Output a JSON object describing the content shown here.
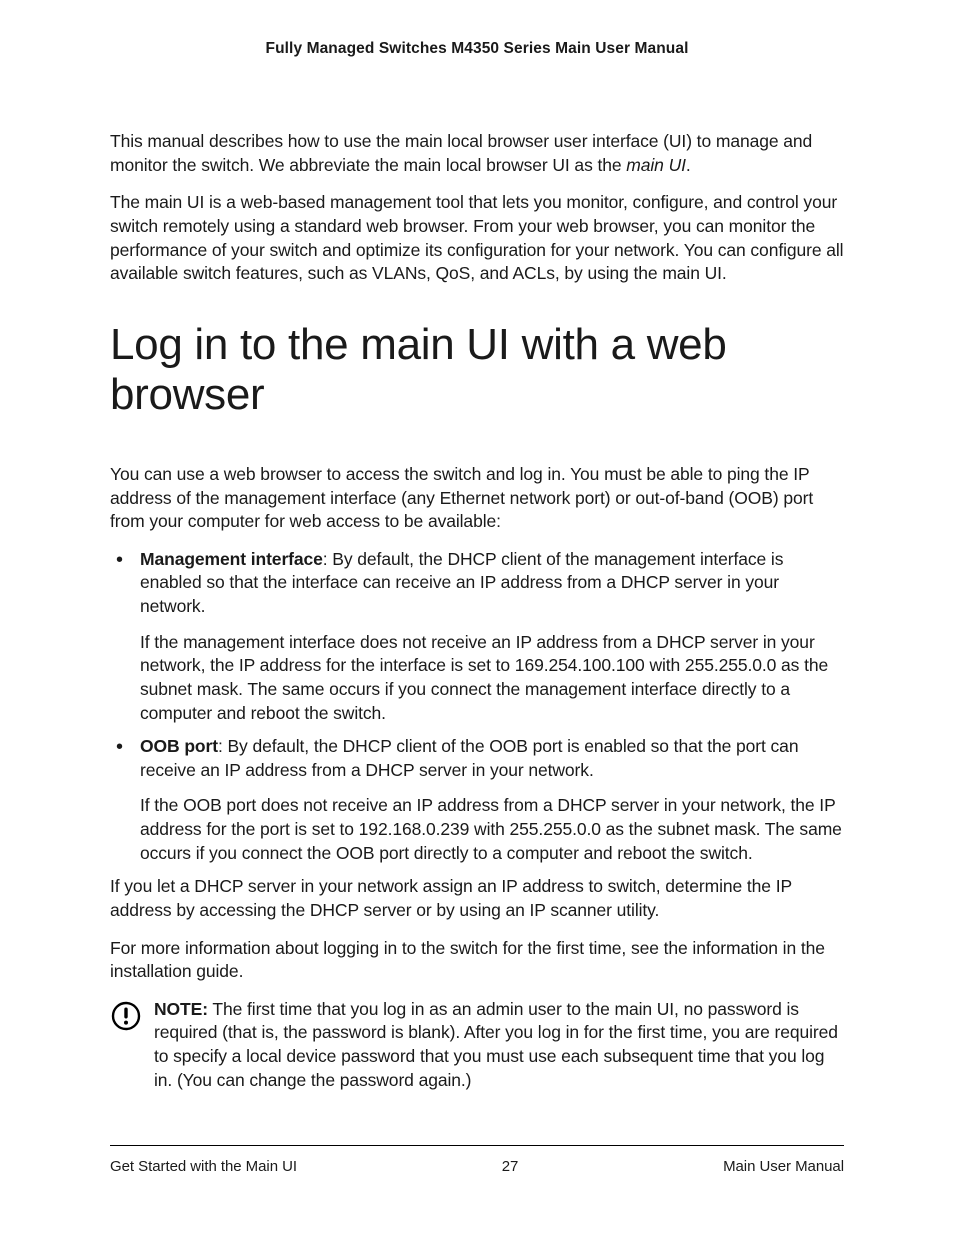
{
  "header": {
    "title": "Fully Managed Switches M4350 Series Main User Manual"
  },
  "intro": {
    "p1a": "This manual describes how to use the main local browser user interface (UI) to manage and monitor the switch. We abbreviate the main local browser UI as the ",
    "p1_em": "main UI",
    "p1b": ".",
    "p2": "The main UI is a web-based management tool that lets you monitor, configure, and control your switch remotely using a standard web browser. From your web browser, you can monitor the performance of your switch and optimize its configuration for your network. You can configure all available switch features, such as VLANs, QoS, and ACLs, by using the main UI."
  },
  "section": {
    "title": "Log in to the main UI with a web browser",
    "lead": "You can use a web browser to access the switch and log in. You must be able to ping the IP address of the management interface (any Ethernet network port) or out-of-band (OOB) port from your computer for web access to be available:",
    "bullets": [
      {
        "term": "Management interface",
        "desc": ": By default, the DHCP client of the management interface is enabled so that the interface can receive an IP address from a DHCP server in your network.",
        "sub": "If the management interface does not receive an IP address from a DHCP server in your network, the IP address for the interface is set to 169.254.100.100 with 255.255.0.0 as the subnet mask. The same occurs if you connect the management interface directly to a computer and reboot the switch."
      },
      {
        "term": "OOB port",
        "desc": ": By default, the DHCP client of the OOB port is enabled so that the port can receive an IP address from a DHCP server in your network.",
        "sub": "If the OOB port does not receive an IP address from a DHCP server in your network, the IP address for the port is set to 192.168.0.239 with 255.255.0.0 as the subnet mask. The same occurs if you connect the OOB port directly to a computer and reboot the switch."
      }
    ],
    "after1": "If you let a DHCP server in your network assign an IP address to switch, determine the IP address by accessing the DHCP server or by using an IP scanner utility.",
    "after2": "For more information about logging in to the switch for the first time, see the information in the installation guide.",
    "note": {
      "label": "NOTE:",
      "text": "  The first time that you log in as an admin user to the main UI, no password is required (that is, the password is blank). After you log in for the first time, you are required to specify a local device password that you must use each subsequent time that you log in. (You can change the password again.)"
    }
  },
  "footer": {
    "left": "Get Started with the Main UI",
    "center": "27",
    "right": "Main User Manual"
  }
}
